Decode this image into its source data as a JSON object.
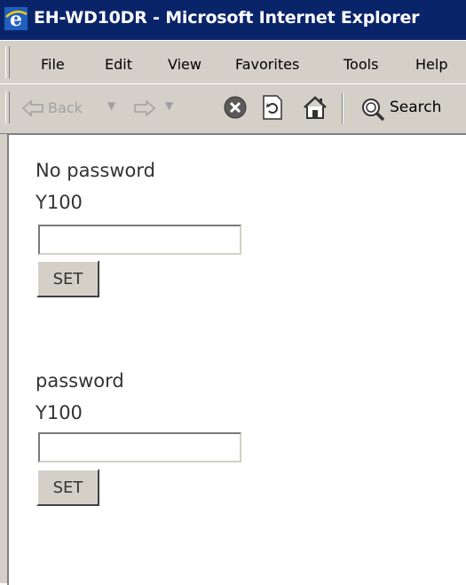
{
  "window": {
    "title": "EH-WD10DR - Microsoft Internet Explorer"
  },
  "menu": {
    "items": [
      "File",
      "Edit",
      "View",
      "Favorites",
      "Tools",
      "Help"
    ]
  },
  "toolbar": {
    "back_label": "Back",
    "search_label": "Search"
  },
  "content": {
    "section1": {
      "heading": "No password",
      "label": "Y100",
      "input_value": "",
      "button_label": "SET"
    },
    "section2": {
      "heading": "password",
      "label": "Y100",
      "input_value": "",
      "button_label": "SET"
    }
  },
  "colors": {
    "titlebar": "#0a246a",
    "chrome": "#d4d0c8",
    "content_bg": "#ffffff"
  }
}
